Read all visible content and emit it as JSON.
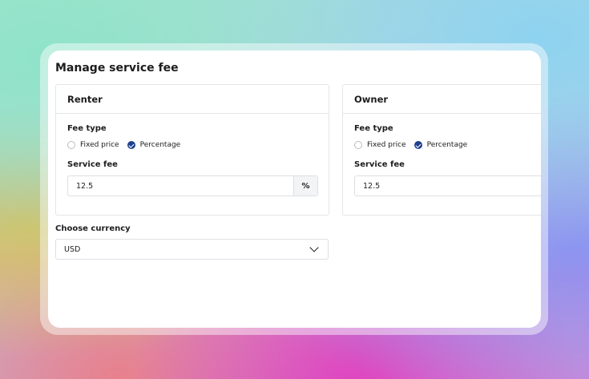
{
  "page": {
    "title": "Manage service fee"
  },
  "renter": {
    "title": "Renter",
    "fee_type_label": "Fee type",
    "options": [
      "Fixed price",
      "Percentage"
    ],
    "selected": "Percentage",
    "service_fee_label": "Service fee",
    "service_fee_value": "12.5",
    "suffix": "%"
  },
  "owner": {
    "title": "Owner",
    "fee_type_label": "Fee type",
    "options": [
      "Fixed price",
      "Percentage"
    ],
    "selected": "Percentage",
    "service_fee_label": "Service fee",
    "service_fee_value": "12.5"
  },
  "currency": {
    "label": "Choose currency",
    "selected": "USD"
  },
  "colors": {
    "accent": "#1f3f8f",
    "border": "#e3e5e8",
    "text": "#1d1d1f"
  }
}
